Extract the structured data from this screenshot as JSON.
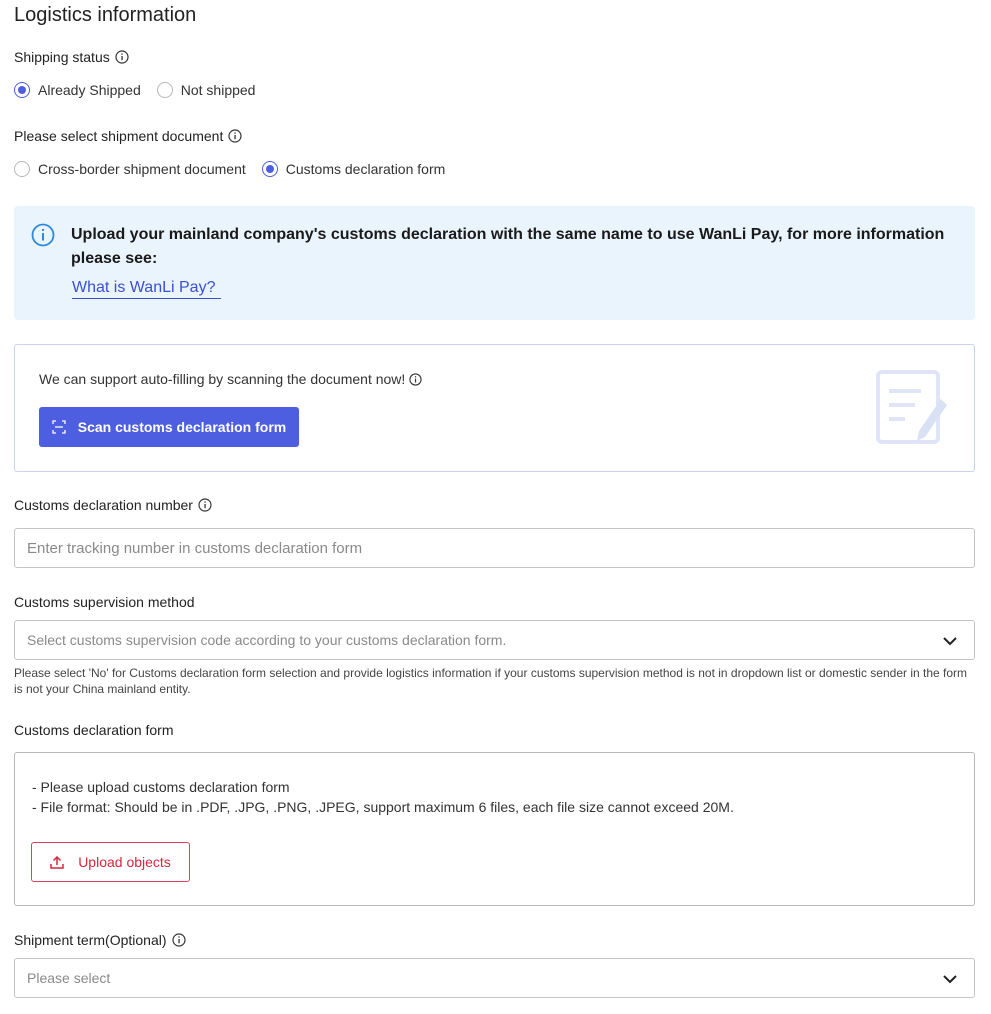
{
  "page": {
    "title": "Logistics information"
  },
  "shipping_status": {
    "label": "Shipping status",
    "options": [
      {
        "label": "Already Shipped",
        "checked": true
      },
      {
        "label": "Not shipped",
        "checked": false
      }
    ]
  },
  "shipment_document": {
    "label": "Please select shipment document",
    "options": [
      {
        "label": "Cross-border shipment document",
        "checked": false
      },
      {
        "label": "Customs declaration form",
        "checked": true
      }
    ]
  },
  "notice": {
    "text": "Upload your mainland company's customs declaration with the same name to use WanLi Pay, for more information please see:",
    "link": "What is WanLi Pay?"
  },
  "scan": {
    "text": "We can support auto-filling by scanning the document now!",
    "button": "Scan customs declaration form"
  },
  "declaration_number": {
    "label": "Customs declaration number",
    "placeholder": "Enter tracking number in customs declaration form"
  },
  "supervision_method": {
    "label": "Customs supervision method",
    "placeholder": "Select customs supervision code according to your customs declaration form.",
    "hint": "Please select 'No' for Customs declaration form selection and provide logistics information if your customs supervision method is not in dropdown list or domestic sender in the form is not your China mainland entity."
  },
  "declaration_form": {
    "label": "Customs declaration form",
    "line1": "- Please upload customs declaration form",
    "line2": "- File format: Should be in .PDF, .JPG, .PNG, .JPEG, support maximum 6 files, each file size cannot exceed 20M.",
    "button": "Upload objects"
  },
  "shipment_term": {
    "label": "Shipment term(Optional)",
    "placeholder": "Please select"
  },
  "colors": {
    "primary": "#4d5fe0",
    "link": "#3b4fd4",
    "danger": "#d7263d",
    "notice_bg": "#eaf4fc"
  }
}
